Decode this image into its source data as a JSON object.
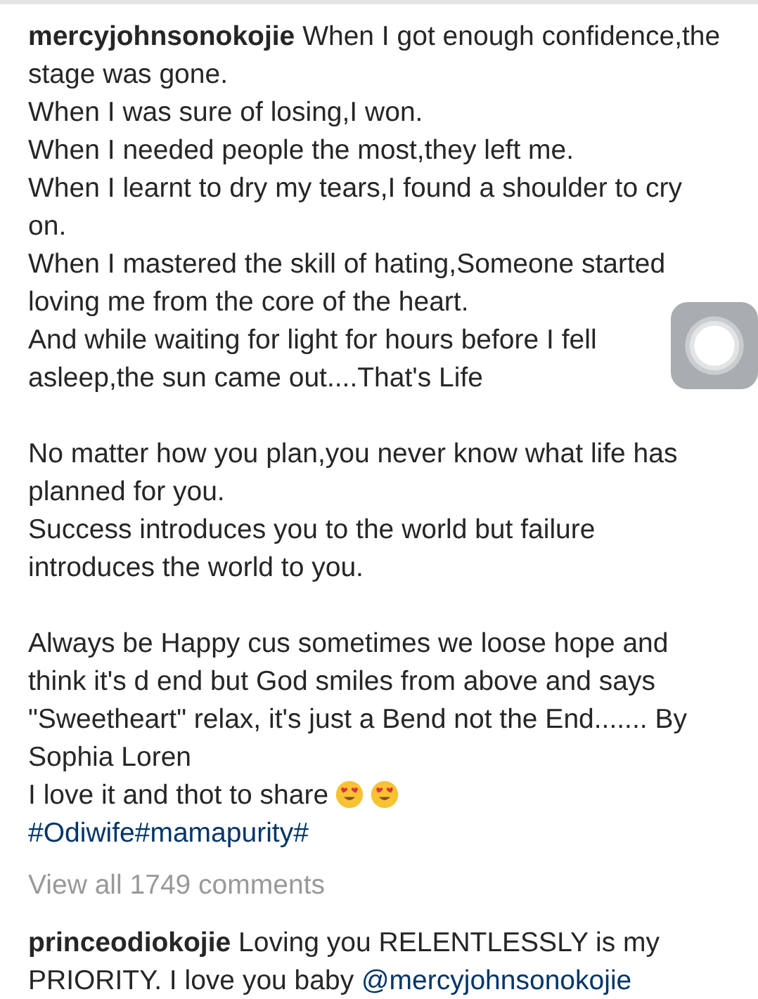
{
  "caption": {
    "username": "mercyjohnsonokojie",
    "paragraphs": [
      [
        {
          "kind": "text",
          "text": "When I got enough confidence,the stage was gone."
        },
        {
          "kind": "text",
          "text": "When I was sure of losing,I won."
        },
        {
          "kind": "text",
          "text": "When I needed people the most,they left me."
        },
        {
          "kind": "text",
          "text": "When I learnt to dry my tears,I found a shoulder to cry on."
        },
        {
          "kind": "text",
          "text": "When I mastered the skill of hating,Someone started loving me from the core of the heart."
        },
        {
          "kind": "text",
          "text": "And while waiting for light for hours before I fell asleep,the sun came out....That's Life"
        }
      ],
      [
        {
          "kind": "text",
          "text": "No matter how you plan,you never know what life has planned for you."
        },
        {
          "kind": "text",
          "text": "Success introduces you to the world but failure introduces the world to you."
        }
      ],
      [
        {
          "kind": "text",
          "text": "Always be Happy cus sometimes we loose hope and think it's d end but God smiles from above and says \"Sweetheart\" relax, it's just a Bend not the End....... By Sophia Loren"
        },
        {
          "kind": "emoji_text",
          "text": "I love it and thot to share"
        },
        {
          "kind": "hashtags",
          "text": "#Odiwife#mamapurity#"
        }
      ]
    ]
  },
  "view_all_comments": "View all 1749 comments",
  "comments": [
    {
      "username": "princeodiokojie",
      "text": "Loving you RELENTLESSLY is my PRIORITY. I love you baby",
      "mention": "@mercyjohnsonokojie"
    }
  ]
}
